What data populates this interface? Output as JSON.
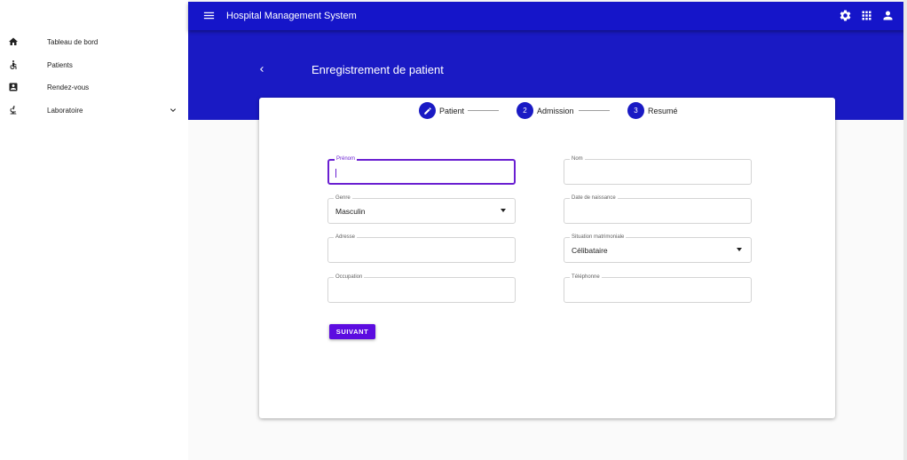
{
  "sidebar": {
    "items": [
      {
        "label": "Tableau de bord",
        "icon": "home-icon"
      },
      {
        "label": "Patients",
        "icon": "accessible-icon"
      },
      {
        "label": "Rendez-vous",
        "icon": "contact-card-icon"
      },
      {
        "label": "Laboratoire",
        "icon": "microscope-icon",
        "expandable": true
      }
    ]
  },
  "topbar": {
    "title": "Hospital Management System",
    "icons": [
      "menu-icon",
      "settings-icon",
      "apps-icon",
      "account-icon"
    ],
    "color": "#1515c9"
  },
  "header": {
    "title": "Enregistrement de patient",
    "back_icon": "chevron-left-icon",
    "color": "#1a1ac4"
  },
  "stepper": {
    "steps": [
      {
        "number": "1",
        "label": "Patient",
        "state": "editing",
        "icon": "pencil-icon"
      },
      {
        "number": "2",
        "label": "Admission",
        "state": "pending"
      },
      {
        "number": "3",
        "label": "Resumé",
        "state": "pending"
      }
    ]
  },
  "form": {
    "prenom": {
      "label": "Prénom",
      "value": ""
    },
    "nom": {
      "label": "Nom",
      "value": ""
    },
    "genre": {
      "label": "Genre",
      "value": "Masculin"
    },
    "date_naissance": {
      "label": "Date de naissance",
      "value": ""
    },
    "adresse": {
      "label": "Adresse",
      "value": ""
    },
    "situation": {
      "label": "Situation matrimoniale",
      "value": "Célibataire"
    },
    "occupation": {
      "label": "Occupation",
      "value": ""
    },
    "telephone": {
      "label": "Téléphonne",
      "value": ""
    },
    "next_label": "SUIVANT",
    "accent": "#5c0ce0"
  }
}
